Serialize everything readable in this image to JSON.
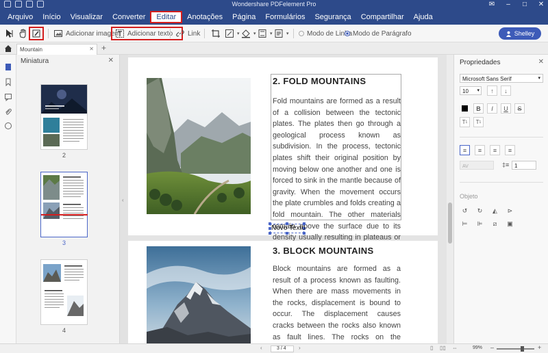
{
  "app": {
    "title": "Wondershare PDFelement Pro"
  },
  "menu": {
    "items": [
      {
        "label": "Arquivo",
        "active": false
      },
      {
        "label": "Início",
        "active": false
      },
      {
        "label": "Visualizar",
        "active": false
      },
      {
        "label": "Converter",
        "active": false
      },
      {
        "label": "Editar",
        "active": true
      },
      {
        "label": "Anotações",
        "active": false
      },
      {
        "label": "Página",
        "active": false
      },
      {
        "label": "Formulários",
        "active": false
      },
      {
        "label": "Segurança",
        "active": false
      },
      {
        "label": "Compartilhar",
        "active": false
      },
      {
        "label": "Ajuda",
        "active": false
      }
    ]
  },
  "toolbar": {
    "add_image": "Adicionar imagem",
    "add_text": "Adicionar texto",
    "link": "Link",
    "line_mode": "Modo de Linha",
    "paragraph_mode": "Modo de Parágrafo",
    "selected_mode": "paragraph",
    "user": "Shelley"
  },
  "tabs": {
    "document": "Mountain"
  },
  "thumbnails": {
    "title": "Miniatura",
    "pages": [
      {
        "number": "2",
        "selected": false
      },
      {
        "number": "3",
        "selected": true
      },
      {
        "number": "4",
        "selected": false
      }
    ]
  },
  "document": {
    "section1": {
      "heading": "2. FOLD MOUNTAINS",
      "body": "Fold mountains are formed as a result of a collision between the tectonic plates. The plates then go through a geological process known as subdivision. In the process, tectonic plates shift their original position by moving below one another and one is forced to sink in the mantle because of gravity. When the movement occurs the plate crumbles and folds creating a fold mountain. The other materials remain above the surface due to its density usually resulting in plateaus or hills."
    },
    "new_text": "Novo Texto",
    "section2": {
      "heading": "3. BLOCK MOUNTAINS",
      "body": "Block mountains are formed as a result of a process known as faulting. When there are mass movements in the rocks, displacement is bound to occur. The displacement causes cracks between the rocks also known as fault lines. The rocks on the different sides of the fault line move above and below each other"
    }
  },
  "properties": {
    "title": "Propriedades",
    "font": "Microsoft Sans Serif",
    "size": "10",
    "line_spacing": "1",
    "object_section": "Objeto"
  },
  "status": {
    "page_indicator": "3 / 4",
    "zoom": "99%"
  },
  "colors": {
    "brand": "#2d4a8a",
    "accent": "#3d5bb8",
    "highlight": "#d41e1e"
  }
}
